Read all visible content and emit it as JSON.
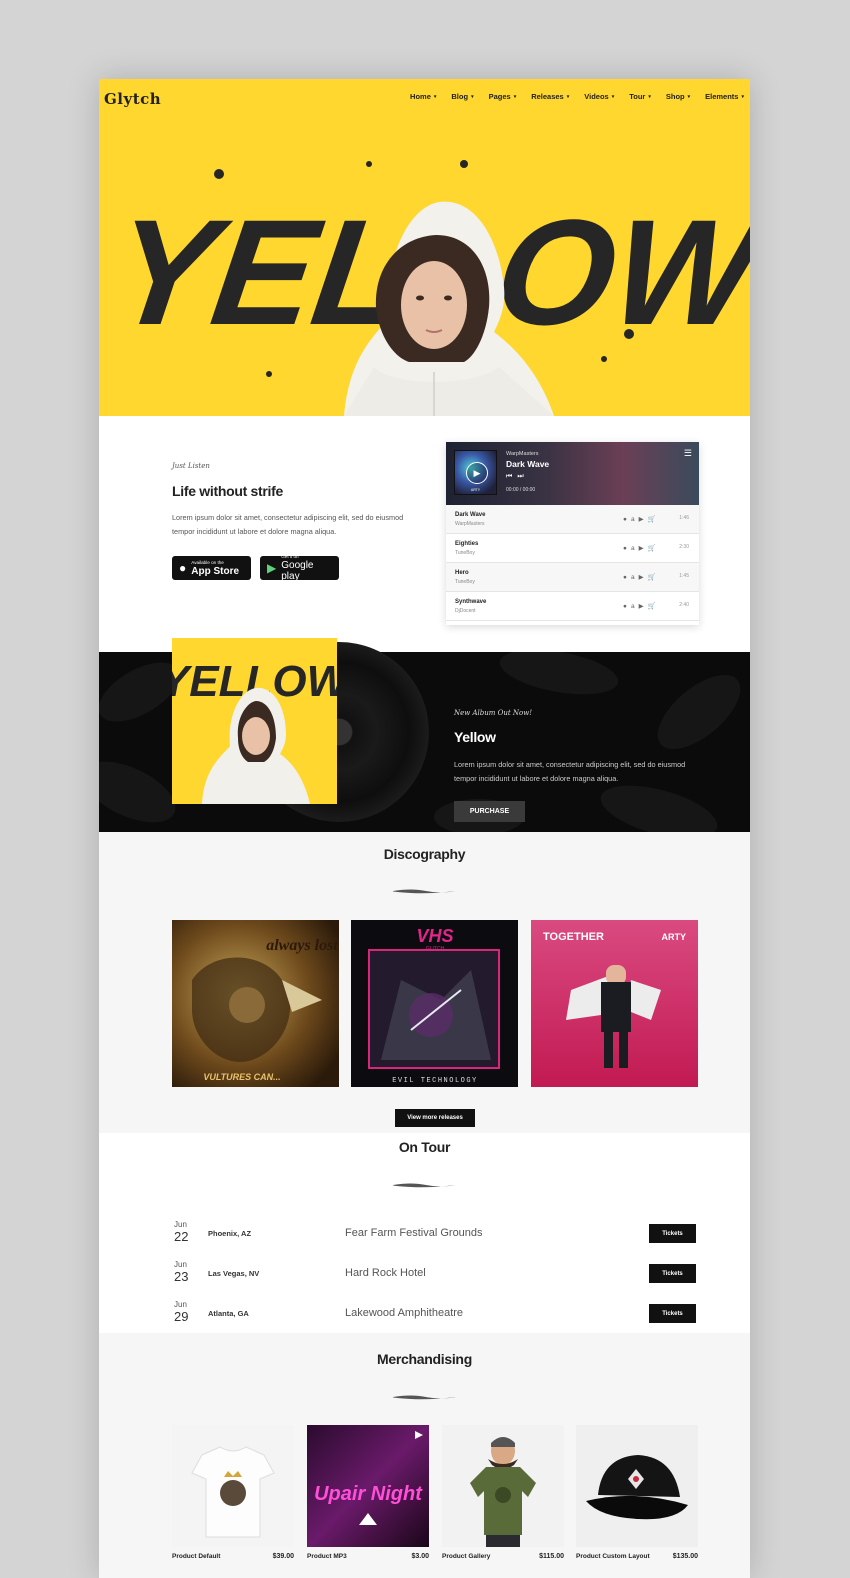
{
  "header": {
    "logo": "Glytch",
    "nav": [
      {
        "label": "Home"
      },
      {
        "label": "Blog"
      },
      {
        "label": "Pages"
      },
      {
        "label": "Releases"
      },
      {
        "label": "Videos"
      },
      {
        "label": "Tour"
      },
      {
        "label": "Shop"
      },
      {
        "label": "Elements"
      }
    ],
    "caret": "▾"
  },
  "hero": {
    "word": "YELLOW"
  },
  "listen": {
    "kicker": "Just Listen",
    "title": "Life without strife",
    "text": "Lorem ipsum dolor sit amet, consectetur adipiscing elit, sed do eiusmod tempor incididunt ut labore et dolore magna aliqua.",
    "app_store": {
      "small": "Available on the",
      "big": "App Store"
    },
    "google_play": {
      "small": "Get it on",
      "big": "Google play"
    }
  },
  "player": {
    "artist": "WarpMasters",
    "title": "Dark Wave",
    "time": "00:00 / 00:00",
    "cover_label": "ARTY",
    "tracks": [
      {
        "name": "Dark Wave",
        "artist": "WarpMasters",
        "duration": "1:46"
      },
      {
        "name": "Eighties",
        "artist": "TuneBoy",
        "duration": "2:30"
      },
      {
        "name": "Hero",
        "artist": "TuneBoy",
        "duration": "1:45"
      },
      {
        "name": "Synthwave",
        "artist": "DjDocent",
        "duration": "2:40"
      }
    ]
  },
  "album": {
    "cover_word": "YELLOW",
    "kicker": "New Album Out Now!",
    "title": "Yellow",
    "text": "Lorem ipsum dolor sit amet, consectetur adipiscing elit, sed do eiusmod tempor incididunt ut labore et dolore magna aliqua.",
    "button": "PURCHASE"
  },
  "discography": {
    "title": "Discography",
    "releases": [
      {
        "top": "always lost",
        "bottom": "VULTURES CAN..."
      },
      {
        "top": "VHS",
        "sub": "GLITCH",
        "bottom": "EVIL TECHNOLOGY"
      },
      {
        "top": "TOGETHER",
        "brand": "ARTY"
      }
    ],
    "button": "View more releases"
  },
  "tour": {
    "title": "On Tour",
    "dates": [
      {
        "month": "Jun",
        "day": "22",
        "city": "Phoenix, AZ",
        "venue": "Fear Farm Festival Grounds",
        "button": "Tickets"
      },
      {
        "month": "Jun",
        "day": "23",
        "city": "Las Vegas, NV",
        "venue": "Hard Rock Hotel",
        "button": "Tickets"
      },
      {
        "month": "Jun",
        "day": "29",
        "city": "Atlanta, GA",
        "venue": "Lakewood Amphitheatre",
        "button": "Tickets"
      }
    ]
  },
  "merch": {
    "title": "Merchandising",
    "products": [
      {
        "name": "Product Default",
        "price": "$39.00"
      },
      {
        "name": "Product MP3",
        "price": "$3.00",
        "art": "Upair Night"
      },
      {
        "name": "Product Gallery",
        "price": "$115.00"
      },
      {
        "name": "Product Custom Layout",
        "price": "$135.00"
      }
    ]
  },
  "colors": {
    "brand_yellow": "#ffd72e",
    "dark": "#111111"
  }
}
